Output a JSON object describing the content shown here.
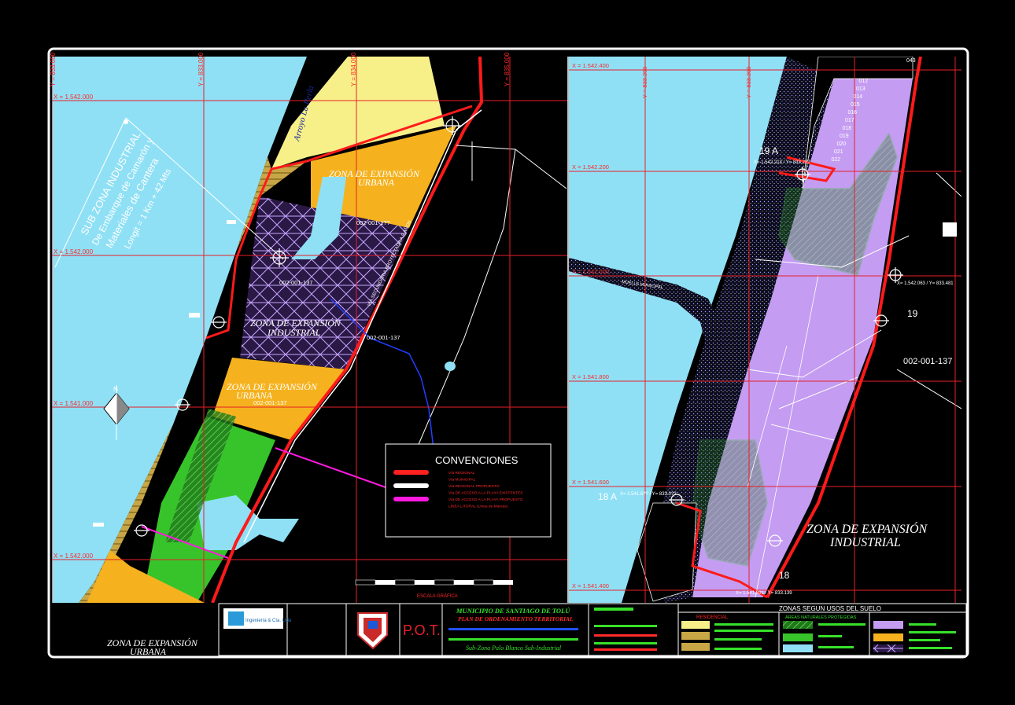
{
  "colors": {
    "background": "#000000",
    "sea": "#8fe0f5",
    "grid": "#e8202a",
    "road": "#ff1a1a",
    "urban_expansion": "#f5b21e",
    "industrial_expansion": "#c49cf2",
    "green_zone": "#37c42a",
    "yellow_zone": "#f7f089",
    "frame": "#ffffff"
  },
  "left_map": {
    "coords_x": [
      "X = 1.542.000",
      "X = 1.542.000",
      "X = 1.541.000",
      "X = 1.542.000"
    ],
    "coords_y": [
      "Y = 833.000",
      "Y = 833.000",
      "Y = 834.000",
      "Y = 835.000"
    ],
    "zone_labels": {
      "urban_top": [
        "ZONA DE EXPANSIÓN",
        "URBANA"
      ],
      "industrial": [
        "ZONA DE EXPANSIÓN",
        "INDUSTRIAL"
      ],
      "urban_mid": [
        "ZONA DE EXPANSIÓN",
        "URBANA"
      ],
      "urban_bottom": [
        "ZONA DE EXPANSIÓN",
        "URBANA"
      ]
    },
    "sub_zone_text": [
      "SUB  ZONA INDUSTRIAL",
      "De Embarque de Camarón y",
      "Materiales de Cantera",
      "Longit = 1 Km + 42 Mts"
    ],
    "creek_label": "Arroyo La Perla",
    "road_label": "VÍA SECUNDARIA PROYECTADA A 8 AÑOS",
    "parcel_labels": [
      "002-001-137",
      "002-001-137",
      "002-001-137",
      "002-001-1??"
    ],
    "north_label": "N",
    "legend": {
      "title": "CONVENCIONES",
      "items": [
        {
          "color": "#ff2020",
          "text": "Vía  REGIONAL"
        },
        {
          "color": "#ff2020",
          "text": "Vía  MUNICIPAL"
        },
        {
          "color": "#ffffff",
          "text": "Vía  REGIONAL PROPUESTO"
        },
        {
          "color": "#ffffff",
          "text": "Vía  DE ACCESO A LA PLAYA EXISTENTES"
        },
        {
          "color": "#ff1adf",
          "text": "Vía DE ACCESO A LA PLAYA PROPUESTO"
        },
        {
          "color": "#ff1adf",
          "text": "LÍNEA LITORAL (Línea de Mareas)"
        }
      ]
    },
    "scale_label": "ESCALA GRÁFICA"
  },
  "right_map": {
    "coords_x": [
      "X = 1.542.400",
      "X = 1.542.200",
      "X = 1.542.000",
      "X = 1.541.800",
      "X = 1.541.600",
      "X = 1.541.400"
    ],
    "coords_y": [
      "Y = 833.200",
      "Y = 833.200"
    ],
    "parcel_numbers": [
      "043",
      "012",
      "013",
      "014",
      "015",
      "016",
      "017",
      "018",
      "019",
      "020",
      "021",
      "022"
    ],
    "points": [
      {
        "label": "19 A",
        "coord": "X= 1.542.213 / Y= 833.282"
      },
      {
        "label": "19",
        "coord": "X= 1.542.063 / Y= 833.481"
      },
      {
        "label": "18 A",
        "coord": "X= 1.541.6?? / Y= 833.0??"
      },
      {
        "label": "18",
        "coord": "X= 1.541.391 / Y= 833.139"
      }
    ],
    "parcel_label": "002-001-137",
    "zone_label": [
      "ZONA DE EXPANSIÓN",
      "INDUSTRIAL"
    ],
    "road_label": "MUELLE MUNICIPAL"
  },
  "title_block": {
    "logo_text": "Ingeniería & Cía. Ltda",
    "municipality": "MUNICIPIO DE SANTIAGO DE TOLÚ",
    "plan": "PLAN DE ORDENAMIENTO TERRITORIAL",
    "subtitle": "Sub-Zona Palo Blanco   Sub-Industrial",
    "pot": "P.O.T.",
    "uses_title": "ZONAS SEGUN USOS DEL SUELO",
    "uses_columns": [
      "RESIDENCIAL",
      "ÁREAS NATURALES PROTEGIDAS",
      ""
    ]
  }
}
